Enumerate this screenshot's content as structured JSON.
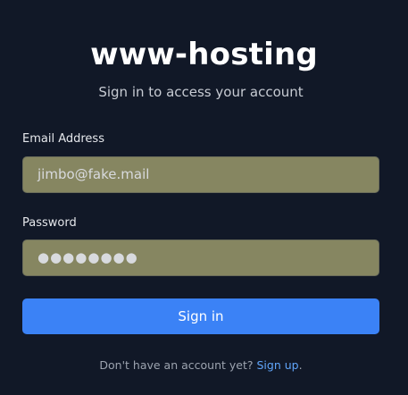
{
  "app": {
    "title": "www-hosting",
    "subtitle": "Sign in to access your account"
  },
  "form": {
    "email": {
      "label": "Email Address",
      "value": "jimbo@fake.mail"
    },
    "password": {
      "label": "Password",
      "value": "●●●●●●●●"
    },
    "submit_label": "Sign in"
  },
  "footer": {
    "prompt": "Don't have an account yet?",
    "link_label": "Sign up",
    "suffix": "."
  },
  "colors": {
    "background": "#111827",
    "field_fill": "#868661",
    "accent": "#3b82f6",
    "link": "#60a5fa"
  }
}
